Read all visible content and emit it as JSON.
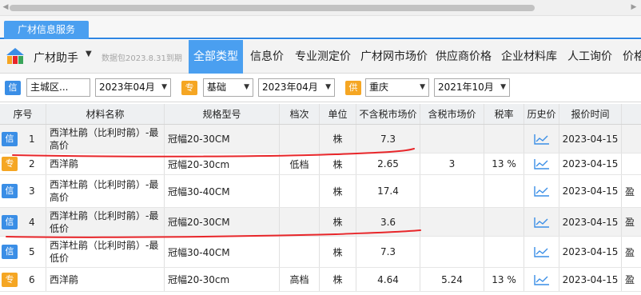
{
  "app_tab": "广材信息服务",
  "toolbar": {
    "app_name": "广材助手",
    "version": "数据包2023.8.31到期",
    "nav": [
      "全部类型",
      "信息价",
      "专业测定价",
      "广材网市场价",
      "供应商价格",
      "企业材料库",
      "人工询价",
      "价格"
    ]
  },
  "filters": {
    "info_badge": "信",
    "region": "主城区...",
    "info_period": "2023年04月",
    "special_badge": "专",
    "special_type": "基础",
    "special_period": "2023年04月",
    "supply_badge": "供",
    "supply_city": "重庆",
    "supply_period": "2021年10月"
  },
  "table": {
    "headers": [
      "序号",
      "材料名称",
      "规格型号",
      "档次",
      "单位",
      "不含税市场价",
      "含税市场价",
      "税率",
      "历史价",
      "报价时间",
      ""
    ],
    "rows": [
      {
        "badge": "信",
        "badge_color": "#3a8ee6",
        "no": "1",
        "name": "西洋杜鹃（比利时鹃）-最高价",
        "spec": "冠幅20-30CM",
        "grade": "",
        "unit": "株",
        "price_ex": "7.3",
        "price_in": "",
        "tax": "",
        "history_icon": "trend-chart-icon",
        "date": "2023-04-15",
        "extra": ""
      },
      {
        "badge": "专",
        "badge_color": "#f5a623",
        "no": "2",
        "name": "西洋鹃",
        "spec": "冠幅20-30cm",
        "grade": "低档",
        "unit": "株",
        "price_ex": "2.65",
        "price_in": "3",
        "tax": "13 %",
        "history_icon": "trend-chart-icon",
        "date": "2023-04-15",
        "extra": ""
      },
      {
        "badge": "信",
        "badge_color": "#3a8ee6",
        "no": "3",
        "name": "西洋杜鹃（比利时鹃）-最高价",
        "spec": "冠幅30-40CM",
        "grade": "",
        "unit": "株",
        "price_ex": "17.4",
        "price_in": "",
        "tax": "",
        "history_icon": "trend-chart-icon",
        "date": "2023-04-15",
        "extra": "盈"
      },
      {
        "badge": "信",
        "badge_color": "#3a8ee6",
        "no": "4",
        "name": "西洋杜鹃（比利时鹃）-最低价",
        "spec": "冠幅20-30CM",
        "grade": "",
        "unit": "株",
        "price_ex": "3.6",
        "price_in": "",
        "tax": "",
        "history_icon": "trend-chart-icon",
        "date": "2023-04-15",
        "extra": "盈"
      },
      {
        "badge": "信",
        "badge_color": "#3a8ee6",
        "no": "5",
        "name": "西洋杜鹃（比利时鹃）-最低价",
        "spec": "冠幅30-40CM",
        "grade": "",
        "unit": "株",
        "price_ex": "7.3",
        "price_in": "",
        "tax": "",
        "history_icon": "trend-chart-icon",
        "date": "2023-04-15",
        "extra": "盈"
      },
      {
        "badge": "专",
        "badge_color": "#f5a623",
        "no": "6",
        "name": "西洋鹃",
        "spec": "冠幅20-30cm",
        "grade": "高档",
        "unit": "株",
        "price_ex": "4.64",
        "price_in": "5.24",
        "tax": "13 %",
        "history_icon": "trend-chart-icon",
        "date": "2023-04-15",
        "extra": "盈"
      }
    ]
  },
  "colors": {
    "accent": "#4a9ff0",
    "info_badge": "#3a8ee6",
    "special_badge": "#f5a623",
    "annotation": "#e8262a"
  }
}
